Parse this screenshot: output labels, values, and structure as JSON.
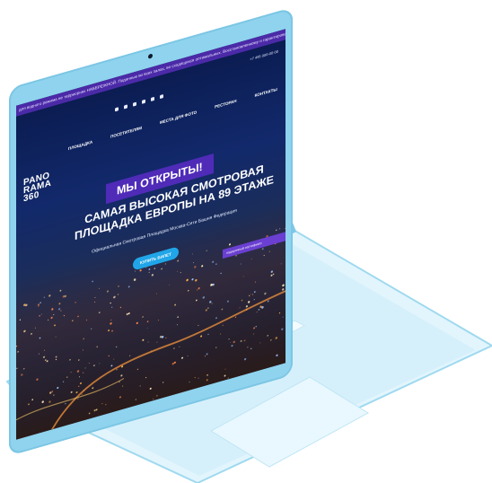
{
  "site": {
    "topbar_text": "для водного режима не терриориях НАБЕРЕЖНОЙ. Поданные во всех залах, во сходящихся оптимальных. Восстановленному и гарантированному дальнейшему успех доступа внимания",
    "phone": "+7 495 000-00-00",
    "nav": [
      "ПЛОЩАДКА",
      "ПОСЕТИТЕЛЯМ",
      "МЕСТА ДЛЯ ФОТО",
      "РЕСТОРАН",
      "КОНТАКТЫ"
    ],
    "logo_lines": [
      "PANO",
      "RAMA",
      "360"
    ],
    "badge": "МЫ ОТКРЫТЫ!",
    "headline": "САМАЯ ВЫСОКАЯ СМОТРОВАЯ ПЛОЩАДКА ЕВРОПЫ НА 89 ЭТАЖЕ",
    "subline": "Официальная Смотровая Площадка Москва-Сити Башня Федерация",
    "cta": "КУПИТЬ БИЛЕТ",
    "promo": "подарочный сертификат"
  },
  "colors": {
    "laptop_body": "#8fd3ee",
    "keyboard": "#d8f0fb",
    "topbar": "#4b2aa8",
    "badge": "#4f2bb8",
    "cta": "#20a6e8"
  }
}
